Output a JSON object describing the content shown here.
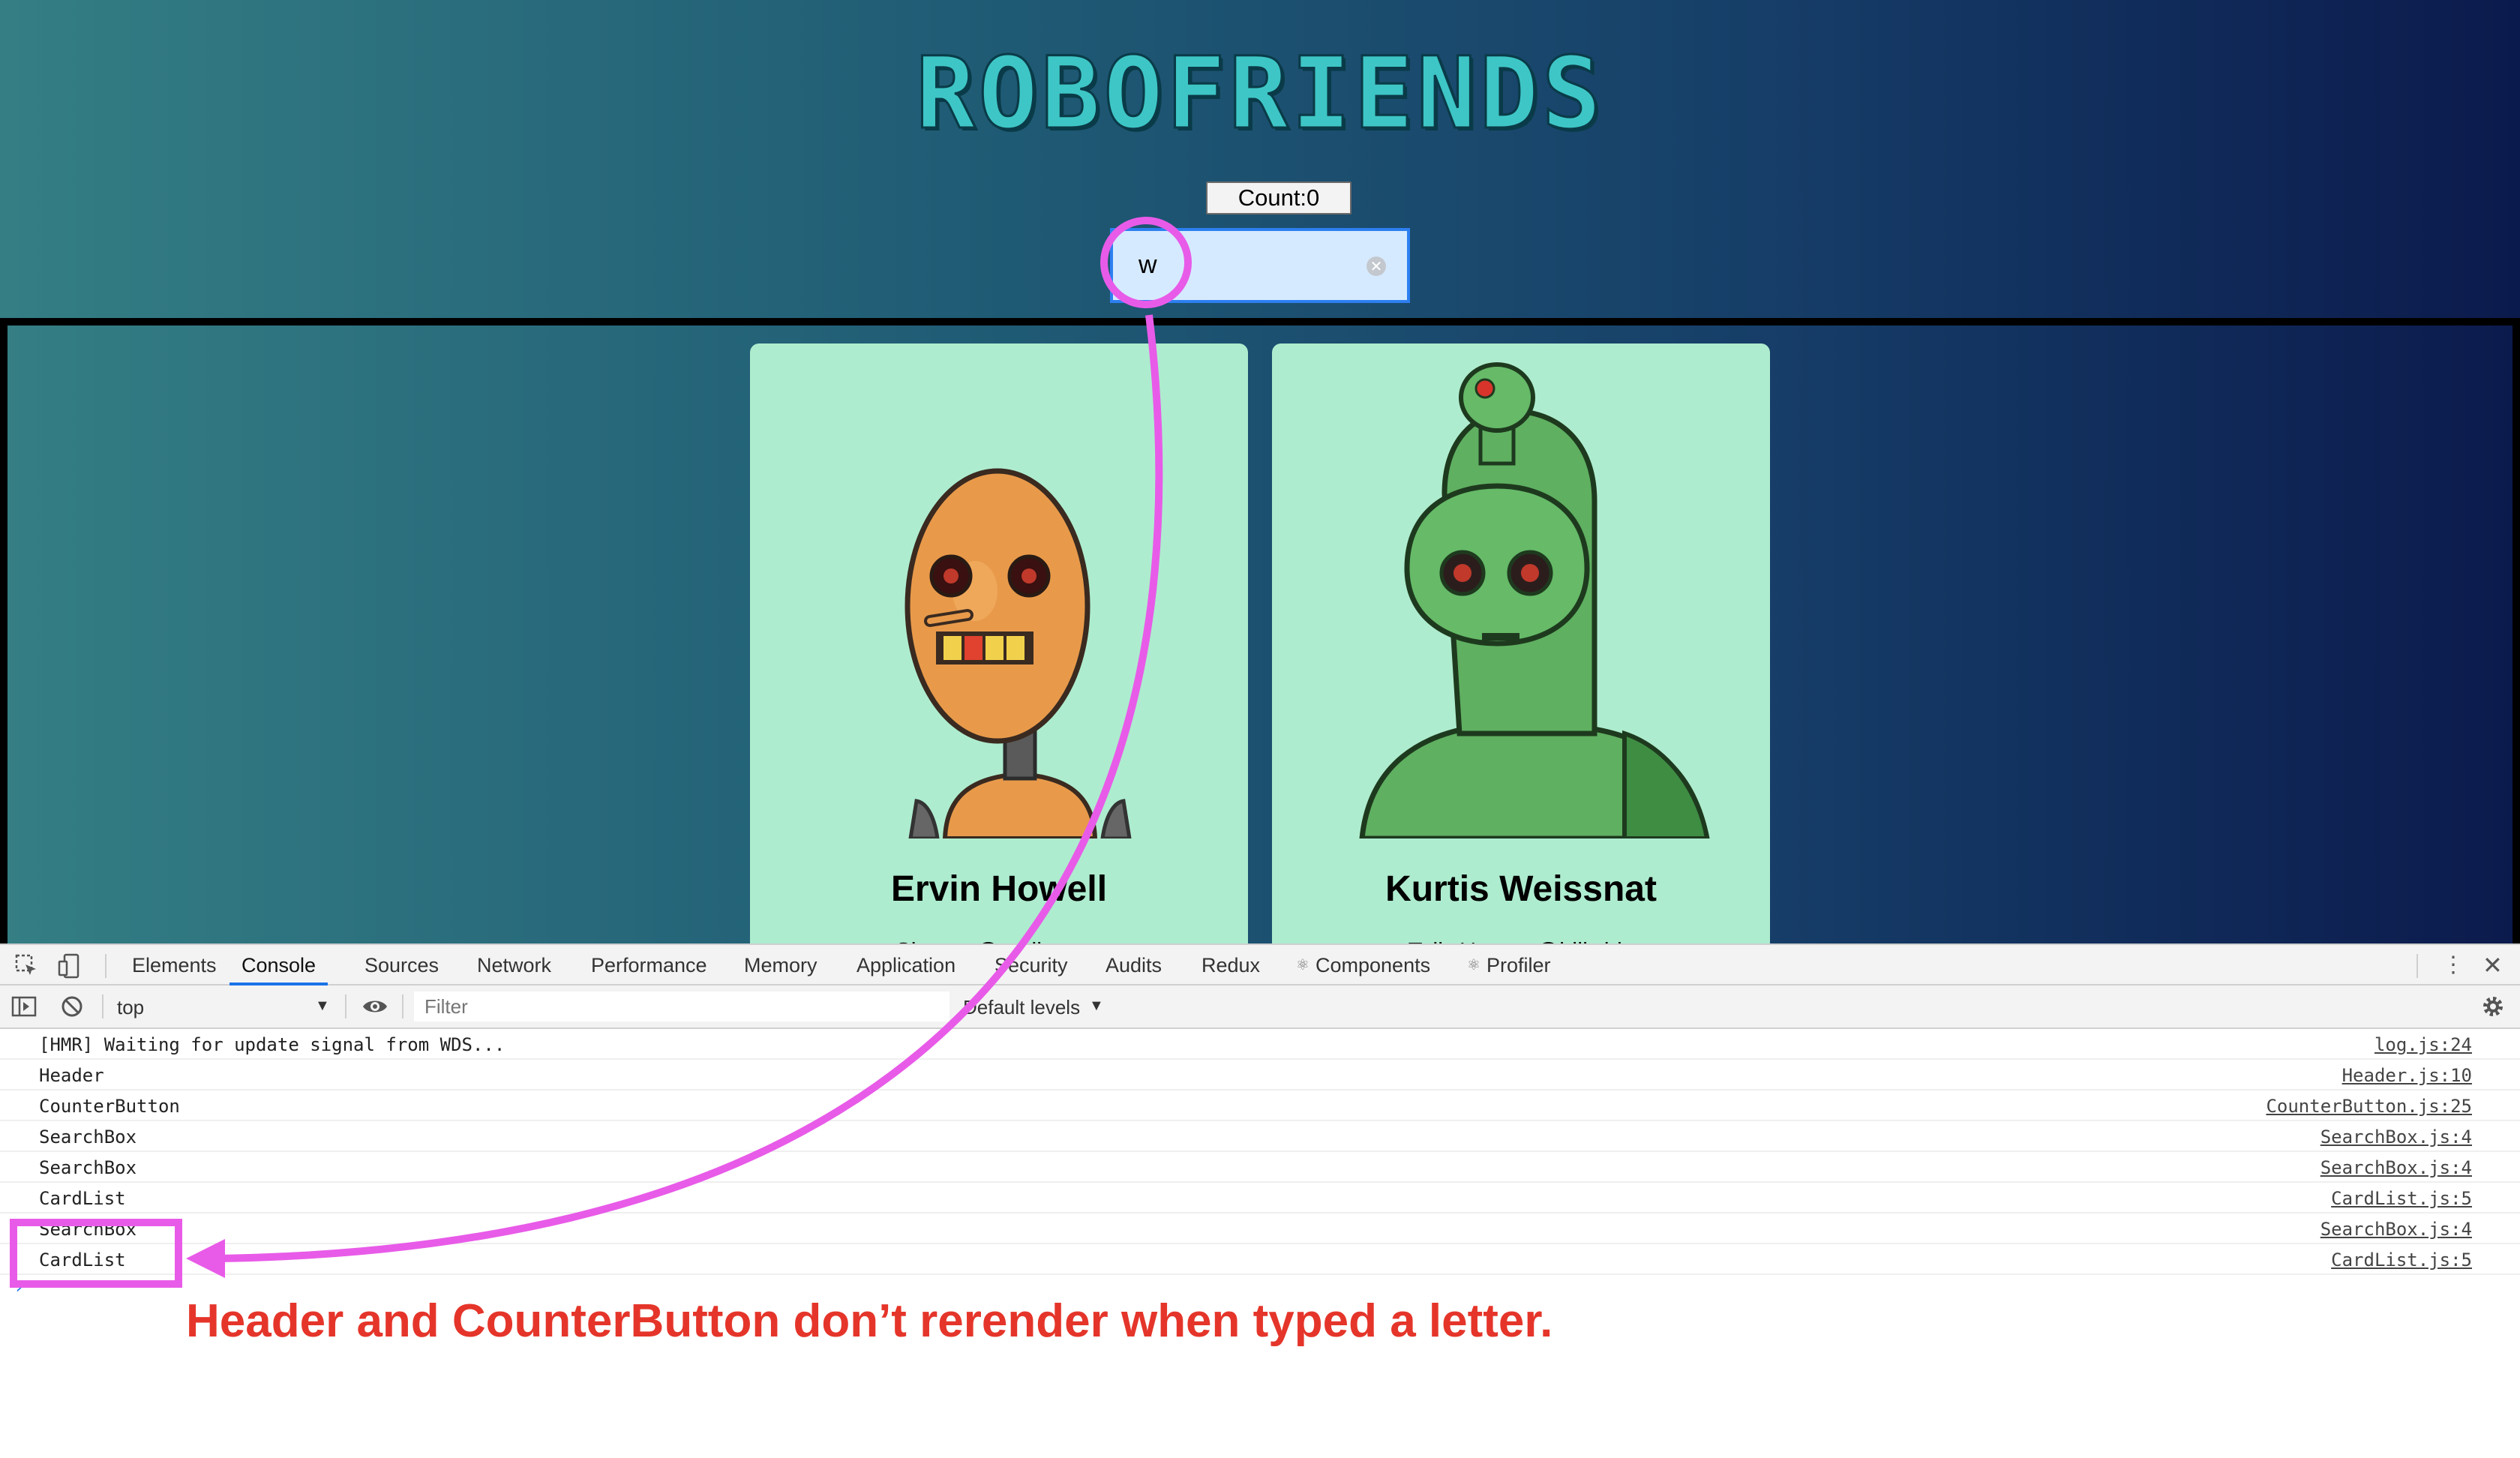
{
  "app": {
    "title": "ROBOFRIENDS",
    "count_button_label": "Count:0",
    "search": {
      "value": "w",
      "clear_icon": "clear-circle-icon"
    },
    "cards": [
      {
        "name": "Ervin Howell",
        "email": "Shanna@melissa.tv",
        "avatar": "orange-robot-avatar"
      },
      {
        "name": "Kurtis Weissnat",
        "email": "Telly.Hoeger@billy.biz",
        "avatar": "green-robot-avatar"
      }
    ]
  },
  "devtools": {
    "tabs": [
      "Elements",
      "Console",
      "Sources",
      "Network",
      "Performance",
      "Memory",
      "Application",
      "Security",
      "Audits",
      "Redux",
      "Components",
      "Profiler"
    ],
    "active_tab": "Console",
    "toolbar": {
      "context": "top",
      "filter_placeholder": "Filter",
      "levels": "Default levels"
    },
    "console_logs": [
      {
        "message": "[HMR] Waiting for update signal from WDS...",
        "source": "log.js:24"
      },
      {
        "message": "Header",
        "source": "Header.js:10"
      },
      {
        "message": "CounterButton",
        "source": "CounterButton.js:25"
      },
      {
        "message": "SearchBox",
        "source": "SearchBox.js:4"
      },
      {
        "message": "SearchBox",
        "source": "SearchBox.js:4"
      },
      {
        "message": "CardList",
        "source": "CardList.js:5"
      },
      {
        "message": "SearchBox",
        "source": "SearchBox.js:4"
      },
      {
        "message": "CardList",
        "source": "CardList.js:5"
      }
    ]
  },
  "annotation": {
    "text": "Header and CounterButton don’t rerender when typed a letter.",
    "color": "#e5352a",
    "highlight_color": "#e85be8"
  }
}
